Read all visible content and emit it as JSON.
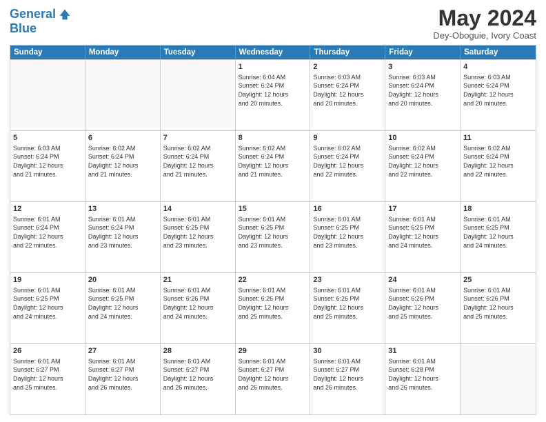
{
  "header": {
    "logo_line1": "General",
    "logo_line2": "Blue",
    "month_title": "May 2024",
    "location": "Dey-Oboguie, Ivory Coast"
  },
  "calendar": {
    "days_of_week": [
      "Sunday",
      "Monday",
      "Tuesday",
      "Wednesday",
      "Thursday",
      "Friday",
      "Saturday"
    ],
    "weeks": [
      [
        {
          "day": "",
          "info": ""
        },
        {
          "day": "",
          "info": ""
        },
        {
          "day": "",
          "info": ""
        },
        {
          "day": "1",
          "info": "Sunrise: 6:04 AM\nSunset: 6:24 PM\nDaylight: 12 hours\nand 20 minutes."
        },
        {
          "day": "2",
          "info": "Sunrise: 6:03 AM\nSunset: 6:24 PM\nDaylight: 12 hours\nand 20 minutes."
        },
        {
          "day": "3",
          "info": "Sunrise: 6:03 AM\nSunset: 6:24 PM\nDaylight: 12 hours\nand 20 minutes."
        },
        {
          "day": "4",
          "info": "Sunrise: 6:03 AM\nSunset: 6:24 PM\nDaylight: 12 hours\nand 20 minutes."
        }
      ],
      [
        {
          "day": "5",
          "info": "Sunrise: 6:03 AM\nSunset: 6:24 PM\nDaylight: 12 hours\nand 21 minutes."
        },
        {
          "day": "6",
          "info": "Sunrise: 6:02 AM\nSunset: 6:24 PM\nDaylight: 12 hours\nand 21 minutes."
        },
        {
          "day": "7",
          "info": "Sunrise: 6:02 AM\nSunset: 6:24 PM\nDaylight: 12 hours\nand 21 minutes."
        },
        {
          "day": "8",
          "info": "Sunrise: 6:02 AM\nSunset: 6:24 PM\nDaylight: 12 hours\nand 21 minutes."
        },
        {
          "day": "9",
          "info": "Sunrise: 6:02 AM\nSunset: 6:24 PM\nDaylight: 12 hours\nand 22 minutes."
        },
        {
          "day": "10",
          "info": "Sunrise: 6:02 AM\nSunset: 6:24 PM\nDaylight: 12 hours\nand 22 minutes."
        },
        {
          "day": "11",
          "info": "Sunrise: 6:02 AM\nSunset: 6:24 PM\nDaylight: 12 hours\nand 22 minutes."
        }
      ],
      [
        {
          "day": "12",
          "info": "Sunrise: 6:01 AM\nSunset: 6:24 PM\nDaylight: 12 hours\nand 22 minutes."
        },
        {
          "day": "13",
          "info": "Sunrise: 6:01 AM\nSunset: 6:24 PM\nDaylight: 12 hours\nand 23 minutes."
        },
        {
          "day": "14",
          "info": "Sunrise: 6:01 AM\nSunset: 6:25 PM\nDaylight: 12 hours\nand 23 minutes."
        },
        {
          "day": "15",
          "info": "Sunrise: 6:01 AM\nSunset: 6:25 PM\nDaylight: 12 hours\nand 23 minutes."
        },
        {
          "day": "16",
          "info": "Sunrise: 6:01 AM\nSunset: 6:25 PM\nDaylight: 12 hours\nand 23 minutes."
        },
        {
          "day": "17",
          "info": "Sunrise: 6:01 AM\nSunset: 6:25 PM\nDaylight: 12 hours\nand 24 minutes."
        },
        {
          "day": "18",
          "info": "Sunrise: 6:01 AM\nSunset: 6:25 PM\nDaylight: 12 hours\nand 24 minutes."
        }
      ],
      [
        {
          "day": "19",
          "info": "Sunrise: 6:01 AM\nSunset: 6:25 PM\nDaylight: 12 hours\nand 24 minutes."
        },
        {
          "day": "20",
          "info": "Sunrise: 6:01 AM\nSunset: 6:25 PM\nDaylight: 12 hours\nand 24 minutes."
        },
        {
          "day": "21",
          "info": "Sunrise: 6:01 AM\nSunset: 6:26 PM\nDaylight: 12 hours\nand 24 minutes."
        },
        {
          "day": "22",
          "info": "Sunrise: 6:01 AM\nSunset: 6:26 PM\nDaylight: 12 hours\nand 25 minutes."
        },
        {
          "day": "23",
          "info": "Sunrise: 6:01 AM\nSunset: 6:26 PM\nDaylight: 12 hours\nand 25 minutes."
        },
        {
          "day": "24",
          "info": "Sunrise: 6:01 AM\nSunset: 6:26 PM\nDaylight: 12 hours\nand 25 minutes."
        },
        {
          "day": "25",
          "info": "Sunrise: 6:01 AM\nSunset: 6:26 PM\nDaylight: 12 hours\nand 25 minutes."
        }
      ],
      [
        {
          "day": "26",
          "info": "Sunrise: 6:01 AM\nSunset: 6:27 PM\nDaylight: 12 hours\nand 25 minutes."
        },
        {
          "day": "27",
          "info": "Sunrise: 6:01 AM\nSunset: 6:27 PM\nDaylight: 12 hours\nand 26 minutes."
        },
        {
          "day": "28",
          "info": "Sunrise: 6:01 AM\nSunset: 6:27 PM\nDaylight: 12 hours\nand 26 minutes."
        },
        {
          "day": "29",
          "info": "Sunrise: 6:01 AM\nSunset: 6:27 PM\nDaylight: 12 hours\nand 26 minutes."
        },
        {
          "day": "30",
          "info": "Sunrise: 6:01 AM\nSunset: 6:27 PM\nDaylight: 12 hours\nand 26 minutes."
        },
        {
          "day": "31",
          "info": "Sunrise: 6:01 AM\nSunset: 6:28 PM\nDaylight: 12 hours\nand 26 minutes."
        },
        {
          "day": "",
          "info": ""
        }
      ]
    ]
  }
}
